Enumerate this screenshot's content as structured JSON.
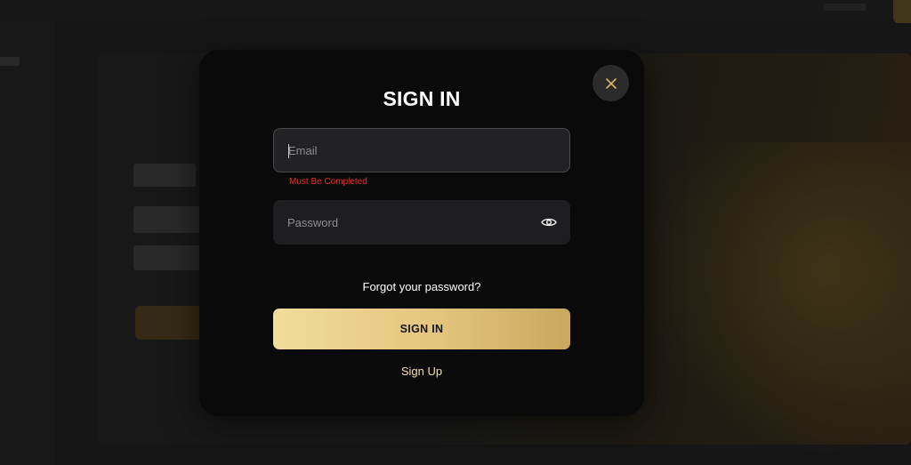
{
  "modal": {
    "title": "SIGN IN",
    "email": {
      "placeholder": "Email",
      "value": "",
      "error": "Must Be Completed"
    },
    "password": {
      "placeholder": "Password",
      "value": ""
    },
    "forgot_label": "Forgot your password?",
    "signin_label": "SIGN IN",
    "signup_label": "Sign Up"
  },
  "icons": {
    "close": "close-icon",
    "eye": "eye-icon"
  },
  "colors": {
    "accent_gold": "#e3c57e",
    "error_red": "#e0352c",
    "modal_bg": "#0a0a0a",
    "field_bg": "#1e1e20"
  }
}
